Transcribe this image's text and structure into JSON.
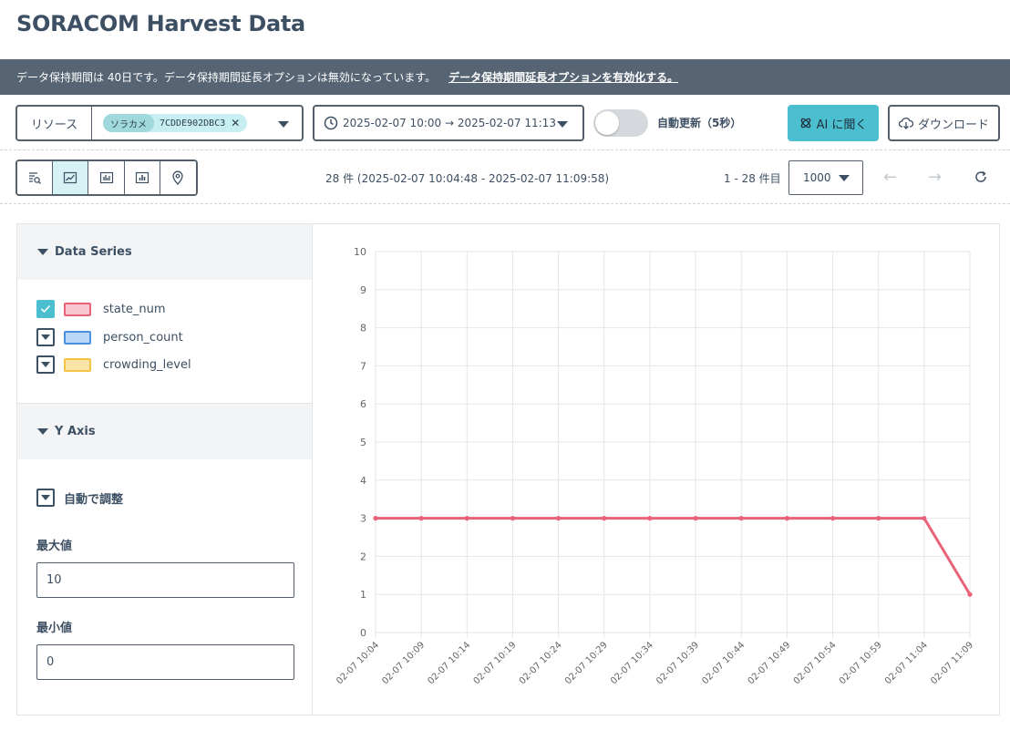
{
  "header": {
    "title": "SORACOM Harvest Data"
  },
  "banner": {
    "message": "データ保持期間は 40日です。データ保持期間延長オプションは無効になっています。",
    "link": "データ保持期間延長オプションを有効化する。"
  },
  "toolbar": {
    "resource_label": "リソース",
    "resource_chip_type": "ソラカメ",
    "resource_chip_id": "7CDDE902DBC3",
    "time_range": "2025-02-07 10:00 → 2025-02-07 11:13",
    "auto_refresh_label": "自動更新（5秒）",
    "auto_refresh_on": false,
    "ai_button": "AI に聞く",
    "download_button": "ダウンロード",
    "ai_color": "#4bbfd0"
  },
  "view": {
    "icons": [
      "table-search-icon",
      "line-chart-icon",
      "bar-chart-icon",
      "column-chart-icon",
      "map-pin-icon"
    ],
    "active_index": 1,
    "count_text": "28 件 (2025-02-07 10:04:48 - 2025-02-07 11:09:58)",
    "page_range": "1 - 28 件目",
    "per_page": "1000"
  },
  "sidebar": {
    "series_title": "Data Series",
    "series": [
      {
        "name": "state_num",
        "checked": true,
        "color": "#e8637a",
        "fill": "#f7c6cf"
      },
      {
        "name": "person_count",
        "checked": false,
        "color": "#4a90e2",
        "fill": "#bcd7f5"
      },
      {
        "name": "crowding_level",
        "checked": false,
        "color": "#f5c343",
        "fill": "#fbe4a8"
      }
    ],
    "yaxis_title": "Y Axis",
    "auto_adjust_label": "自動で調整",
    "max_label": "最大値",
    "max_value": "10",
    "min_label": "最小値",
    "min_value": "0"
  },
  "chart_data": {
    "type": "line",
    "x": [
      "02-07 10:04",
      "02-07 10:09",
      "02-07 10:14",
      "02-07 10:19",
      "02-07 10:24",
      "02-07 10:29",
      "02-07 10:34",
      "02-07 10:39",
      "02-07 10:44",
      "02-07 10:49",
      "02-07 10:54",
      "02-07 10:59",
      "02-07 11:04",
      "02-07 11:09"
    ],
    "series": [
      {
        "name": "state_num",
        "color": "#e8637a",
        "values": [
          3,
          3,
          3,
          3,
          3,
          3,
          3,
          3,
          3,
          3,
          3,
          3,
          3,
          1
        ]
      }
    ],
    "ylim": [
      0,
      10
    ],
    "yticks": [
      0,
      1,
      2,
      3,
      4,
      5,
      6,
      7,
      8,
      9,
      10
    ],
    "grid": true
  }
}
